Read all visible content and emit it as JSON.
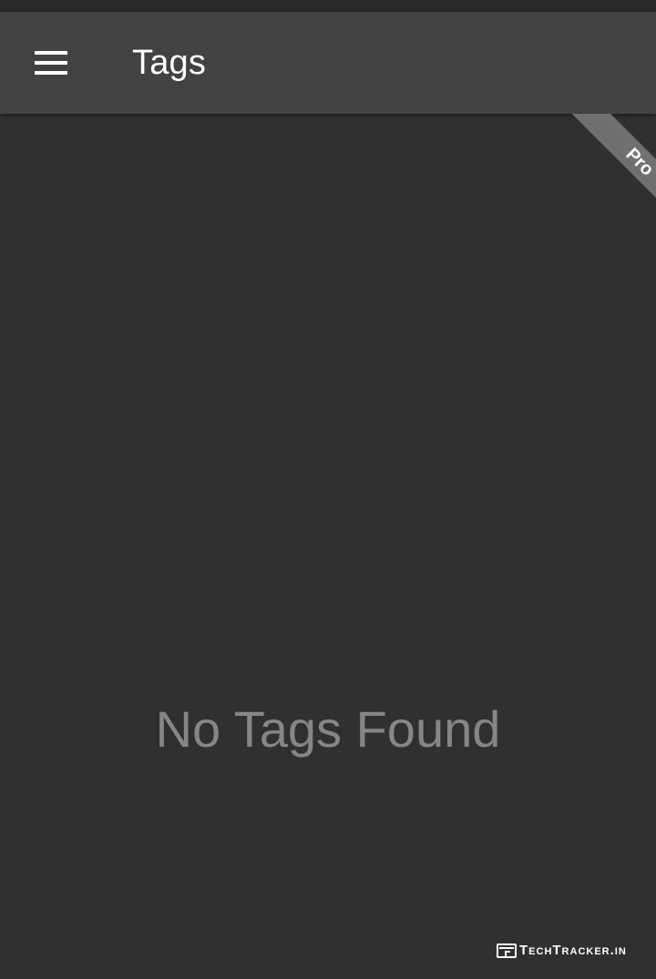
{
  "app_bar": {
    "title": "Tags",
    "menu_icon": "hamburger-menu-icon"
  },
  "ribbon": {
    "label": "Pro"
  },
  "main": {
    "empty_message": "No Tags Found"
  },
  "watermark": {
    "text": "TechTracker.in",
    "icon": "browser-window-icon"
  },
  "colors": {
    "background": "#303030",
    "app_bar": "#424242",
    "ribbon": "#707070",
    "empty_text": "#868686"
  }
}
